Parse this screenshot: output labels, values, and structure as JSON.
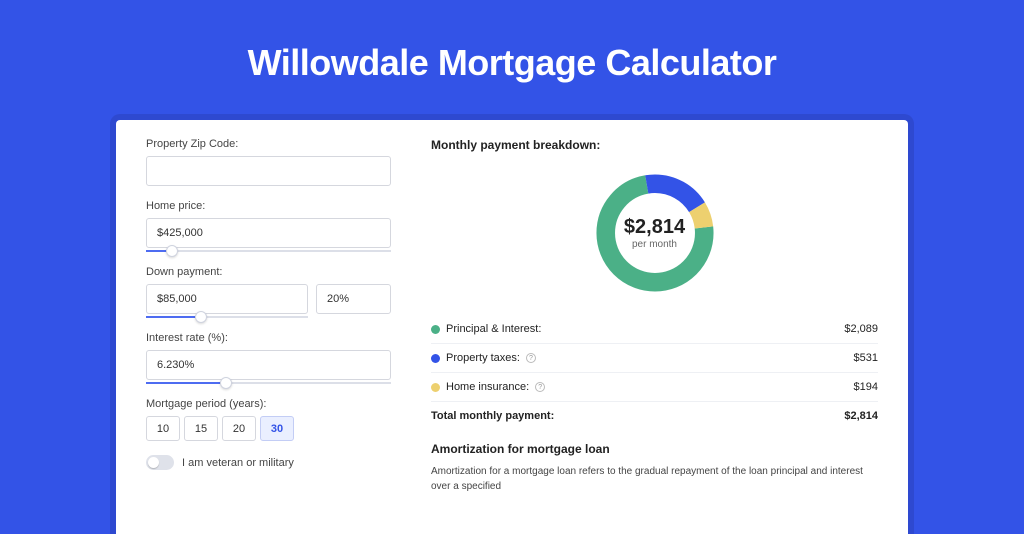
{
  "page": {
    "title": "Willowdale Mortgage Calculator"
  },
  "form": {
    "zip": {
      "label": "Property Zip Code:",
      "value": ""
    },
    "price": {
      "label": "Home price:",
      "value": "$425,000",
      "slider_pct": 8
    },
    "down": {
      "label": "Down payment:",
      "value": "$85,000",
      "percent": "20%",
      "slider_pct": 20
    },
    "rate": {
      "label": "Interest rate (%):",
      "value": "6.230%",
      "slider_pct": 30
    },
    "period": {
      "label": "Mortgage period (years):",
      "options": [
        "10",
        "15",
        "20",
        "30"
      ],
      "active": "30"
    },
    "veteran": {
      "label": "I am veteran or military",
      "on": false
    }
  },
  "breakdown": {
    "title": "Monthly payment breakdown:",
    "center": {
      "amount": "$2,814",
      "sub": "per month"
    },
    "items": [
      {
        "label": "Principal & Interest:",
        "value": "$2,089",
        "color": "#4bb087",
        "info": false
      },
      {
        "label": "Property taxes:",
        "value": "$531",
        "color": "#3353e7",
        "info": true
      },
      {
        "label": "Home insurance:",
        "value": "$194",
        "color": "#edd06f",
        "info": true
      }
    ],
    "total": {
      "label": "Total monthly payment:",
      "value": "$2,814"
    }
  },
  "chart_data": {
    "type": "pie",
    "title": "Monthly payment breakdown",
    "series": [
      {
        "name": "Principal & Interest",
        "value": 2089,
        "color": "#4bb087"
      },
      {
        "name": "Property taxes",
        "value": 531,
        "color": "#3353e7"
      },
      {
        "name": "Home insurance",
        "value": 194,
        "color": "#edd06f"
      }
    ],
    "center_label": "$2,814 per month",
    "donut_inner_ratio": 0.66
  },
  "amort": {
    "title": "Amortization for mortgage loan",
    "text": "Amortization for a mortgage loan refers to the gradual repayment of the loan principal and interest over a specified"
  }
}
